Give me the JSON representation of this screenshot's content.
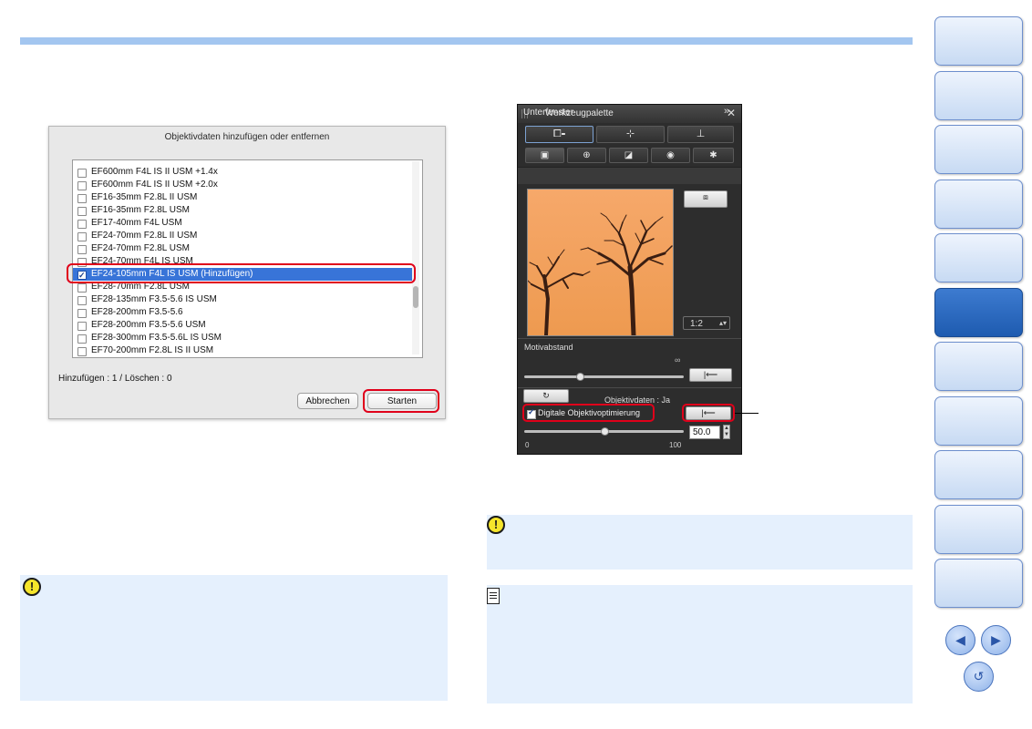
{
  "lens_dialog": {
    "title": "Objektivdaten hinzufügen oder entfernen",
    "lenses": [
      {
        "label": "EF600mm F4L IS II USM +1.4x",
        "checked": false,
        "selected": false
      },
      {
        "label": "EF600mm F4L IS II USM +2.0x",
        "checked": false,
        "selected": false
      },
      {
        "label": "EF16-35mm F2.8L II USM",
        "checked": false,
        "selected": false
      },
      {
        "label": "EF16-35mm F2.8L USM",
        "checked": false,
        "selected": false
      },
      {
        "label": "EF17-40mm F4L USM",
        "checked": false,
        "selected": false
      },
      {
        "label": "EF24-70mm F2.8L II USM",
        "checked": false,
        "selected": false
      },
      {
        "label": "EF24-70mm F2.8L USM",
        "checked": false,
        "selected": false
      },
      {
        "label": "EF24-70mm F4L IS USM",
        "checked": false,
        "selected": false
      },
      {
        "label": "EF24-105mm F4L IS USM (Hinzufügen)",
        "checked": true,
        "selected": true
      },
      {
        "label": "EF28-70mm F2.8L USM",
        "checked": false,
        "selected": false
      },
      {
        "label": "EF28-135mm F3.5-5.6 IS USM",
        "checked": false,
        "selected": false
      },
      {
        "label": "EF28-200mm F3.5-5.6",
        "checked": false,
        "selected": false
      },
      {
        "label": "EF28-200mm F3.5-5.6 USM",
        "checked": false,
        "selected": false
      },
      {
        "label": "EF28-300mm F3.5-5.6L IS USM",
        "checked": false,
        "selected": false
      },
      {
        "label": "EF70-200mm F2.8L IS II USM",
        "checked": false,
        "selected": false
      }
    ],
    "status": "Hinzufügen : 1 / Löschen : 0",
    "cancel_label": "Abbrechen",
    "start_label": "Starten"
  },
  "tool_palette": {
    "title": "Werkzeugpalette",
    "close_glyph": "✕",
    "main_tabs": [
      "⧠⁃",
      "⊹",
      "⊥"
    ],
    "sub_tabs": [
      "▣",
      "⊕",
      "◪",
      "◉",
      "✱"
    ],
    "subwindow_label": "Unterfenster",
    "chevron_glyph": "»",
    "fit_button_glyph": "⧈",
    "zoom_value": "1:2",
    "subject_distance_label": "Motivabstand",
    "infinity_label": "∞",
    "reset_glyph": "|⟵",
    "rotate_glyph": "↻",
    "lens_data_label": "Objektivdaten : Ja",
    "digital_lens_optimizer_label": "Digitale Objektivoptimierung",
    "digital_lens_optimizer_checked": true,
    "digital_lens_optimizer_value": "50.0",
    "slider_min": "0",
    "slider_max": "100",
    "subject_distance_level": 0.35,
    "optimizer_level": 0.5
  },
  "notes": {
    "warning_icon": "!",
    "memo_icon": "memo-icon"
  },
  "navigation": {
    "tab_count": 11,
    "active_tab_index": 5,
    "prev_glyph": "◀",
    "next_glyph": "▶",
    "return_glyph": "↺"
  },
  "colors": {
    "accent_blue": "#3874d8",
    "highlight_red": "#e0001a",
    "note_background": "#e5f0fd",
    "nav_active": "#1e5bb0"
  }
}
